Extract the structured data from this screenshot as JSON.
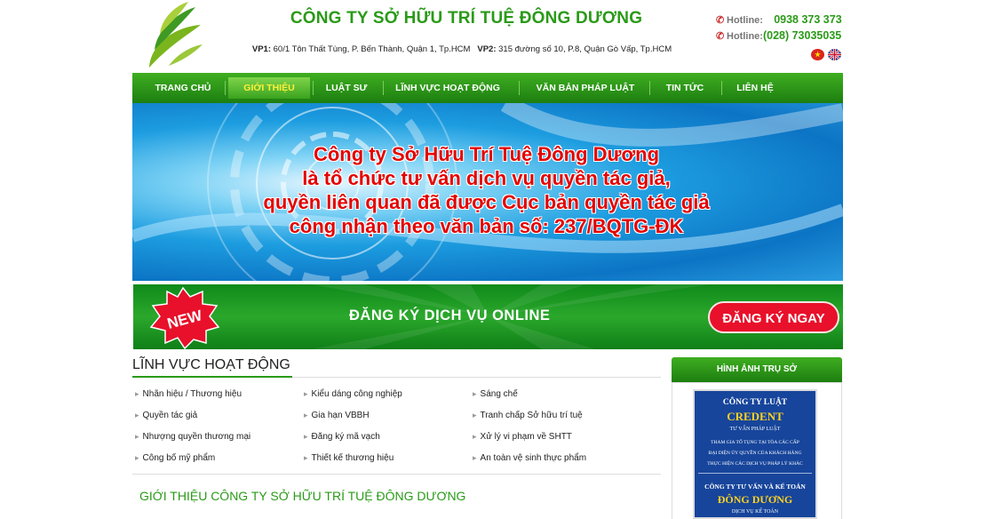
{
  "header": {
    "company_name": "CÔNG TY SỞ HỮU TRÍ TUỆ ĐÔNG DƯƠNG",
    "vp1_label": "VP1:",
    "vp1_address": "60/1 Tôn Thất Tùng, P. Bến Thành, Quận 1,  Tp.HCM",
    "vp2_label": "VP2:",
    "vp2_address": "315 đường số 10, P.8, Quận Gò Vấp, Tp.HCM",
    "hotline1_label": "Hotline:",
    "hotline1_number": "0938 373 373",
    "hotline2_label": "Hotline:",
    "hotline2_number": "(028) 73035035"
  },
  "nav": {
    "items": [
      {
        "label": "TRANG CHỦ"
      },
      {
        "label": "GIỚI THIỆU"
      },
      {
        "label": "LUẬT SƯ"
      },
      {
        "label": "LĨNH VỰC HOẠT ĐỘNG"
      },
      {
        "label": "VĂN BẢN PHÁP LUẬT"
      },
      {
        "label": "TIN TỨC"
      },
      {
        "label": "LIÊN HỆ"
      }
    ],
    "active_index": 1
  },
  "banner": {
    "line1": "Công ty Sở Hữu Trí Tuệ Đông Dương",
    "line2": "là tổ chức tư vấn dịch vụ quyền tác giả,",
    "line3": "quyền liên quan đã được Cục bản quyền tác giả",
    "line4": "công nhận theo văn bản số: 237/BQTG-ĐK"
  },
  "online": {
    "badge": "NEW",
    "label": "ĐĂNG KÝ DỊCH VỤ ONLINE",
    "button": "ĐĂNG KÝ NGAY"
  },
  "fields": {
    "title": "LĨNH VỰC HOẠT ĐỘNG",
    "items": [
      "Nhãn hiệu / Thương hiệu",
      "Kiểu dáng công nghiệp",
      "Sáng chế",
      "Quyền tác giả",
      "Gia hạn VBBH",
      "Tranh chấp Sở hữu trí tuệ",
      "Nhượng quyền thương mại",
      "Đăng ký mã vạch",
      "Xử lý vi phạm về SHTT",
      "Công bố mỹ phẩm",
      "Thiết kế thương hiệu",
      "An toàn vệ sinh thực phẩm"
    ]
  },
  "intro": {
    "title": "GIỚI THIỆU CÔNG TY SỞ HỮU TRÍ TUỆ ĐÔNG DƯƠNG"
  },
  "sidebar": {
    "title": "HÌNH ẢNH TRỤ SỞ",
    "sign": {
      "line1": "CÔNG TY LUẬT",
      "line2": "CREDENT",
      "line3": "TƯ VẤN PHÁP LUẬT",
      "line4": "THAM GIA TỐ TỤNG TẠI TÒA CÁC CẤP",
      "line5": "ĐẠI DIỆN ỦY QUYỀN CỦA KHÁCH HÀNG",
      "line6": "THỰC HIỆN CÁC DỊCH VỤ PHÁP LÝ KHÁC",
      "line7": "CÔNG TY TƯ VẤN VÀ KẾ TOÁN",
      "line8": "ĐÔNG DƯƠNG",
      "line9": "DỊCH VỤ KẾ TOÁN"
    }
  },
  "colors": {
    "brand_green": "#2a9a18",
    "nav_active_text": "#ffef3a",
    "banner_text": "#e40000",
    "register_button": "#e8102a"
  }
}
